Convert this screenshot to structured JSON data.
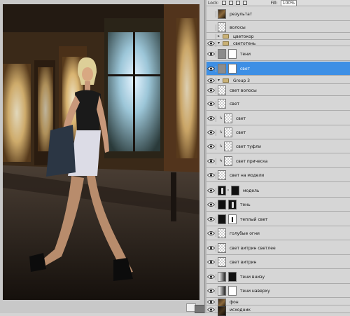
{
  "toolbar": {
    "lock_label": "Lock:",
    "fill_label": "Fill:",
    "fill_value": "100%"
  },
  "layers": [
    {
      "name": "результат",
      "visible": false,
      "kind": "photo"
    },
    {
      "name": "волосы",
      "visible": false,
      "kind": "transparent"
    },
    {
      "name": "цветокор",
      "visible": false,
      "kind": "group-closed"
    },
    {
      "name": "светотень",
      "visible": true,
      "kind": "group-open"
    },
    {
      "name": "тени",
      "visible": true,
      "kind": "adjust-gray-mask-white"
    },
    {
      "name": "свет",
      "visible": true,
      "kind": "adjust-gray-mask-white",
      "selected": true
    },
    {
      "name": "Group 3",
      "visible": true,
      "kind": "group-open"
    },
    {
      "name": "свет волосы",
      "visible": true,
      "kind": "transparent"
    },
    {
      "name": "свет",
      "visible": true,
      "kind": "transparent"
    },
    {
      "name": "свет",
      "visible": true,
      "kind": "clipped-transparent"
    },
    {
      "name": "свет",
      "visible": true,
      "kind": "clipped-transparent"
    },
    {
      "name": "свет туфли",
      "visible": true,
      "kind": "clipped-transparent"
    },
    {
      "name": "свет прическа",
      "visible": true,
      "kind": "clipped-transparent"
    },
    {
      "name": "свет на модели",
      "visible": true,
      "kind": "transparent"
    },
    {
      "name": "модель",
      "visible": true,
      "kind": "figure-mask"
    },
    {
      "name": "тень",
      "visible": true,
      "kind": "dark-mask"
    },
    {
      "name": "теплый свет",
      "visible": true,
      "kind": "dark-mask-white"
    },
    {
      "name": "голубые огни",
      "visible": true,
      "kind": "transparent"
    },
    {
      "name": "свет витрин светлее",
      "visible": true,
      "kind": "transparent"
    },
    {
      "name": "свет витрин",
      "visible": true,
      "kind": "transparent"
    },
    {
      "name": "тени внизу",
      "visible": true,
      "kind": "levels-black"
    },
    {
      "name": "тени наверху",
      "visible": true,
      "kind": "levels-white"
    },
    {
      "name": "фон",
      "visible": true,
      "kind": "photo"
    },
    {
      "name": "исходник",
      "visible": true,
      "kind": "photo-dark"
    }
  ]
}
